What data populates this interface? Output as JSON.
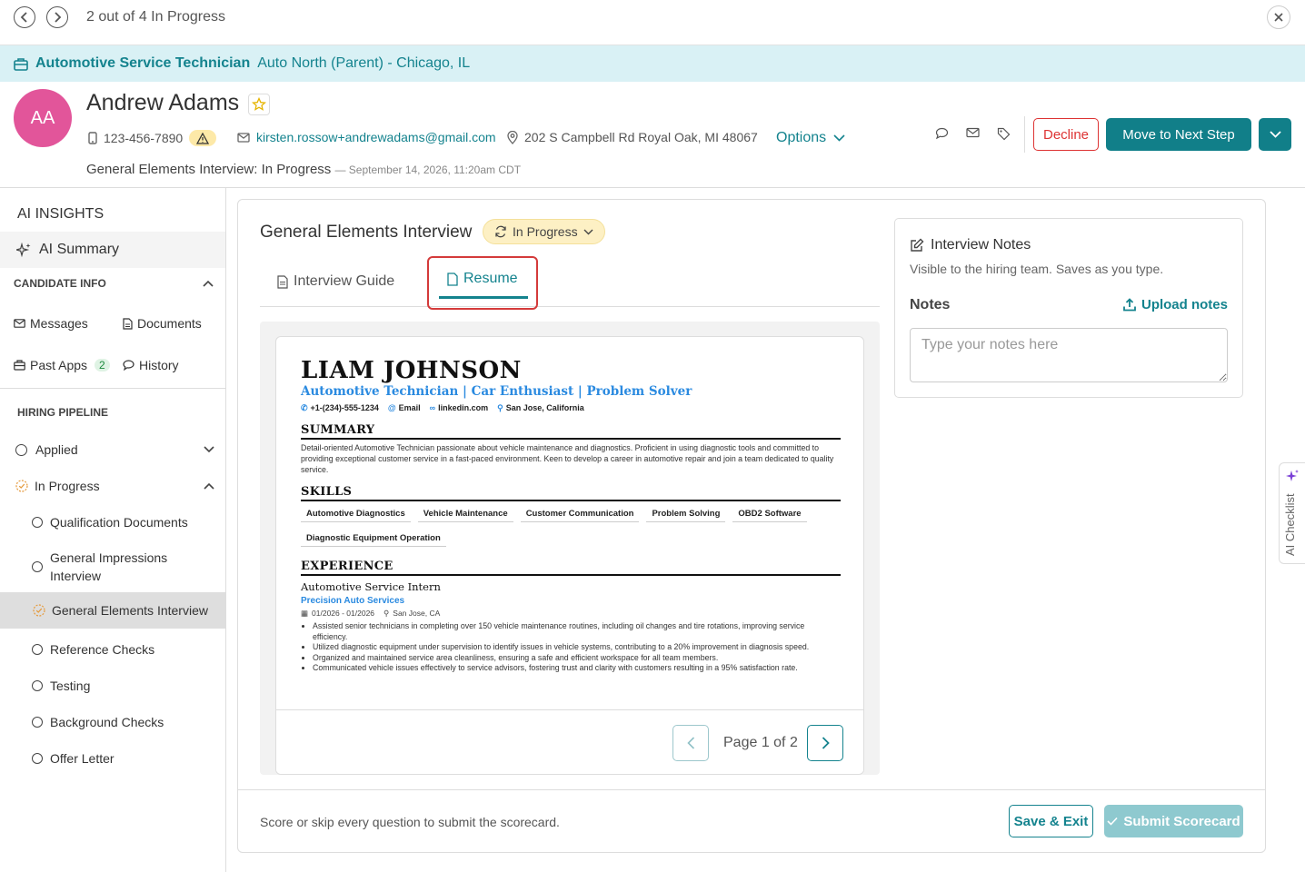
{
  "topbar": {
    "progress_text": "2 out of 4 In Progress"
  },
  "job": {
    "title": "Automotive Service Technician",
    "location": "Auto North (Parent) - Chicago, IL"
  },
  "candidate": {
    "initials": "AA",
    "name": "Andrew Adams",
    "phone": "123-456-7890",
    "email": "kirsten.rossow+andrewadams@gmail.com",
    "address": "202 S Campbell Rd Royal Oak, MI 48067",
    "options_label": "Options",
    "decline_label": "Decline",
    "next_step_label": "Move to Next Step",
    "status_text": "General Elements Interview: In Progress",
    "status_date": "— September 14, 2026, 11:20am CDT"
  },
  "sidebar": {
    "ai_insights_title": "AI INSIGHTS",
    "ai_summary_label": "AI Summary",
    "candidate_info_title": "CANDIDATE INFO",
    "links": {
      "messages": "Messages",
      "documents": "Documents",
      "past_apps": "Past Apps",
      "past_apps_count": "2",
      "history": "History"
    },
    "hiring_pipeline_title": "HIRING PIPELINE",
    "pipeline": [
      {
        "label": "Applied"
      },
      {
        "label": "In Progress"
      },
      {
        "label": "Qualification Documents"
      },
      {
        "label": "General Impressions Interview"
      },
      {
        "label": "General Elements Interview"
      },
      {
        "label": "Reference Checks"
      },
      {
        "label": "Testing"
      },
      {
        "label": "Background Checks"
      },
      {
        "label": "Offer Letter"
      }
    ]
  },
  "main": {
    "title": "General Elements Interview",
    "status_label": "In Progress",
    "tabs": [
      {
        "label": "Interview Guide"
      },
      {
        "label": "Resume"
      }
    ],
    "footer_text": "Score or skip every question to submit the scorecard.",
    "save_exit_label": "Save & Exit",
    "submit_label": "Submit Scorecard"
  },
  "resume": {
    "name": "LIAM JOHNSON",
    "headline": "Automotive Technician | Car Enthusiast | Problem Solver",
    "contact": {
      "phone": "+1-(234)-555-1234",
      "email": "Email",
      "linkedin": "linkedin.com",
      "location": "San Jose, California"
    },
    "summary_title": "SUMMARY",
    "summary": "Detail-oriented Automotive Technician passionate about vehicle maintenance and diagnostics. Proficient in using diagnostic tools and committed to providing exceptional customer service in a fast-paced environment. Keen to develop a career in automotive repair and join a team dedicated to quality service.",
    "skills_title": "SKILLS",
    "skills": [
      "Automotive Diagnostics",
      "Vehicle Maintenance",
      "Customer Communication",
      "Problem Solving",
      "OBD2 Software",
      "Diagnostic Equipment Operation"
    ],
    "experience_title": "EXPERIENCE",
    "role": "Automotive Service Intern",
    "company": "Precision Auto Services",
    "dates": "01/2026 - 01/2026",
    "exp_location": "San Jose, CA",
    "bullets": [
      "Assisted senior technicians in completing over 150 vehicle maintenance routines, including oil changes and tire rotations, improving service efficiency.",
      "Utilized diagnostic equipment under supervision to identify issues in vehicle systems, contributing to a 20% improvement in diagnosis speed.",
      "Organized and maintained service area cleanliness, ensuring a safe and efficient workspace for all team members.",
      "Communicated vehicle issues effectively to service advisors, fostering trust and clarity with customers resulting in a 95% satisfaction rate."
    ],
    "page_indicator": "Page 1 of 2"
  },
  "notes": {
    "title": "Interview Notes",
    "subtitle": "Visible to the hiring team. Saves as you type.",
    "label": "Notes",
    "upload_label": "Upload notes",
    "placeholder": "Type your notes here"
  },
  "ai_checklist_label": "AI Checklist",
  "colors": {
    "accent": "#117f89",
    "banner_bg": "#d9f1f5",
    "avatar": "#e2559a",
    "decline": "#d33333",
    "highlight": "#d43a3a",
    "resume_blue": "#2a8ae0"
  }
}
